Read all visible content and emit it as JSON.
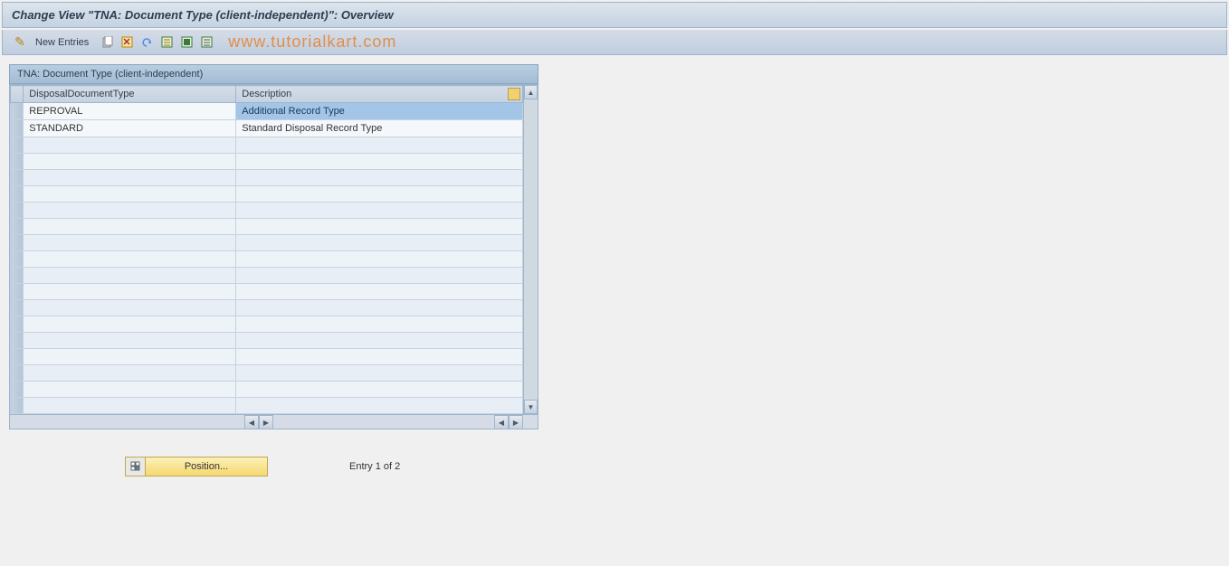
{
  "title": "Change View \"TNA: Document Type (client-independent)\": Overview",
  "toolbar": {
    "new_entries": "New Entries"
  },
  "watermark": "www.tutorialkart.com",
  "panel": {
    "header": "TNA: Document Type (client-independent)",
    "columns": {
      "col1": "DisposalDocumentType",
      "col2": "Description"
    },
    "rows": [
      {
        "type": "REPROVAL",
        "description": "Additional Record Type",
        "selected": true
      },
      {
        "type": "STANDARD",
        "description": "Standard Disposal Record Type",
        "selected": false
      }
    ],
    "empty_row_count": 17
  },
  "footer": {
    "position_button": "Position...",
    "entry_text": "Entry 1 of 2"
  }
}
